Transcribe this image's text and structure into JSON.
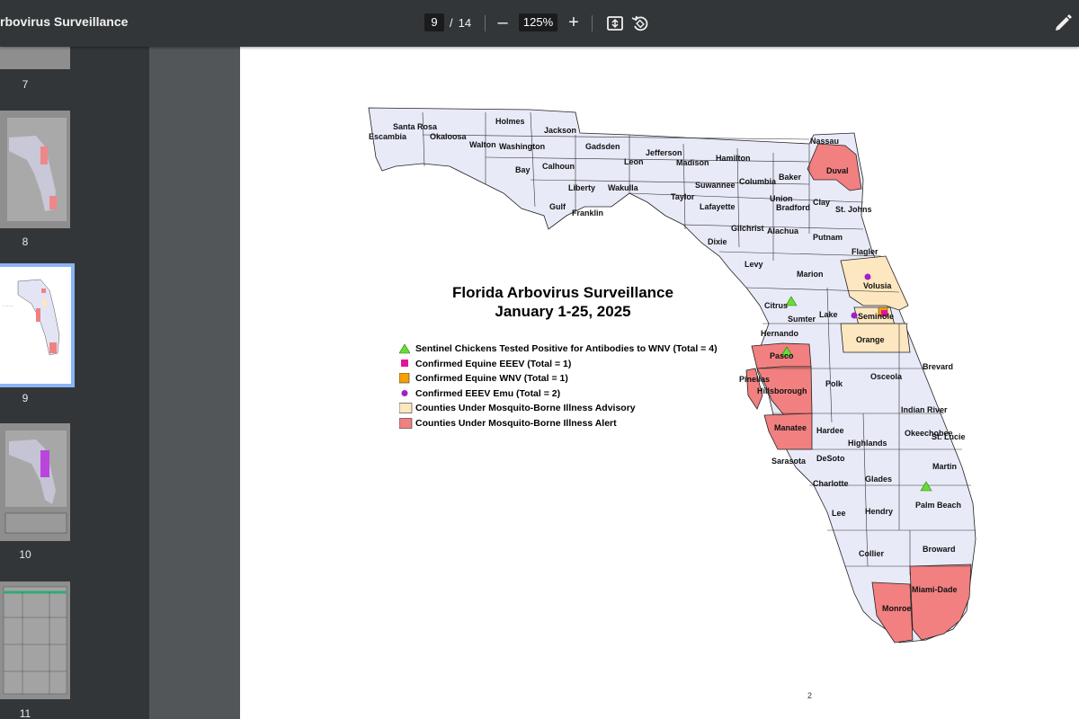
{
  "toolbar": {
    "doc_title": "rbovirus Surveillance",
    "current_page": "9",
    "page_separator": "/",
    "total_pages": "14",
    "zoom_out_label": "–",
    "zoom_level": "125%",
    "zoom_in_label": "+",
    "icons": [
      "fit-page-icon",
      "rotate-icon",
      "edit-pen-icon"
    ]
  },
  "sidebar": {
    "thumbnails": [
      {
        "page": "7"
      },
      {
        "page": "8"
      },
      {
        "page": "9",
        "selected": true
      },
      {
        "page": "10"
      },
      {
        "page": "11"
      }
    ]
  },
  "map": {
    "title_line1": "Florida Arbovirus Surveillance",
    "title_line2": "January 1-25, 2025",
    "legend": [
      {
        "symbol": "green-triangle",
        "color": "#66dd33",
        "label": "Sentinel Chickens Tested Positive for Antibodies to WNV (Total = 4)"
      },
      {
        "symbol": "magenta-square",
        "color": "#e0169a",
        "label": "Confirmed Equine EEEV (Total = 1)"
      },
      {
        "symbol": "orange-square",
        "color": "#f5a000",
        "label": "Confirmed Equine WNV (Total = 1)"
      },
      {
        "symbol": "purple-circle",
        "color": "#a020c8",
        "label": "Confirmed EEEV Emu (Total = 2)"
      },
      {
        "symbol": "advisory-box",
        "color": "#fde7c0",
        "label": "Counties Under Mosquito-Borne Illness Advisory"
      },
      {
        "symbol": "alert-box",
        "color": "#f28080",
        "label": "Counties Under Mosquito-Borne Illness Alert"
      }
    ],
    "colors": {
      "default_county": "#e8eaf8",
      "advisory": "#fde7c0",
      "alert": "#f28080",
      "border": "#222222"
    },
    "counties": [
      "Escambia",
      "Santa Rosa",
      "Okaloosa",
      "Walton",
      "Holmes",
      "Washington",
      "Jackson",
      "Bay",
      "Calhoun",
      "Gadsden",
      "Liberty",
      "Gulf",
      "Franklin",
      "Wakulla",
      "Leon",
      "Jefferson",
      "Madison",
      "Taylor",
      "Hamilton",
      "Suwannee",
      "Lafayette",
      "Columbia",
      "Baker",
      "Nassau",
      "Duval",
      "Union",
      "Bradford",
      "Clay",
      "St. Johns",
      "Gilchrist",
      "Alachua",
      "Dixie",
      "Putnam",
      "Flagler",
      "Levy",
      "Marion",
      "Volusia",
      "Citrus",
      "Sumter",
      "Lake",
      "Seminole",
      "Hernando",
      "Orange",
      "Pasco",
      "Brevard",
      "Osceola",
      "Pinellas",
      "Hillsborough",
      "Polk",
      "Indian River",
      "Manatee",
      "Hardee",
      "Okeechobee",
      "St. Lucie",
      "Highlands",
      "Sarasota",
      "DeSoto",
      "Martin",
      "Charlotte",
      "Glades",
      "Palm Beach",
      "Lee",
      "Hendry",
      "Collier",
      "Broward",
      "Miami-Dade",
      "Monroe"
    ],
    "stray_mark": "2"
  }
}
